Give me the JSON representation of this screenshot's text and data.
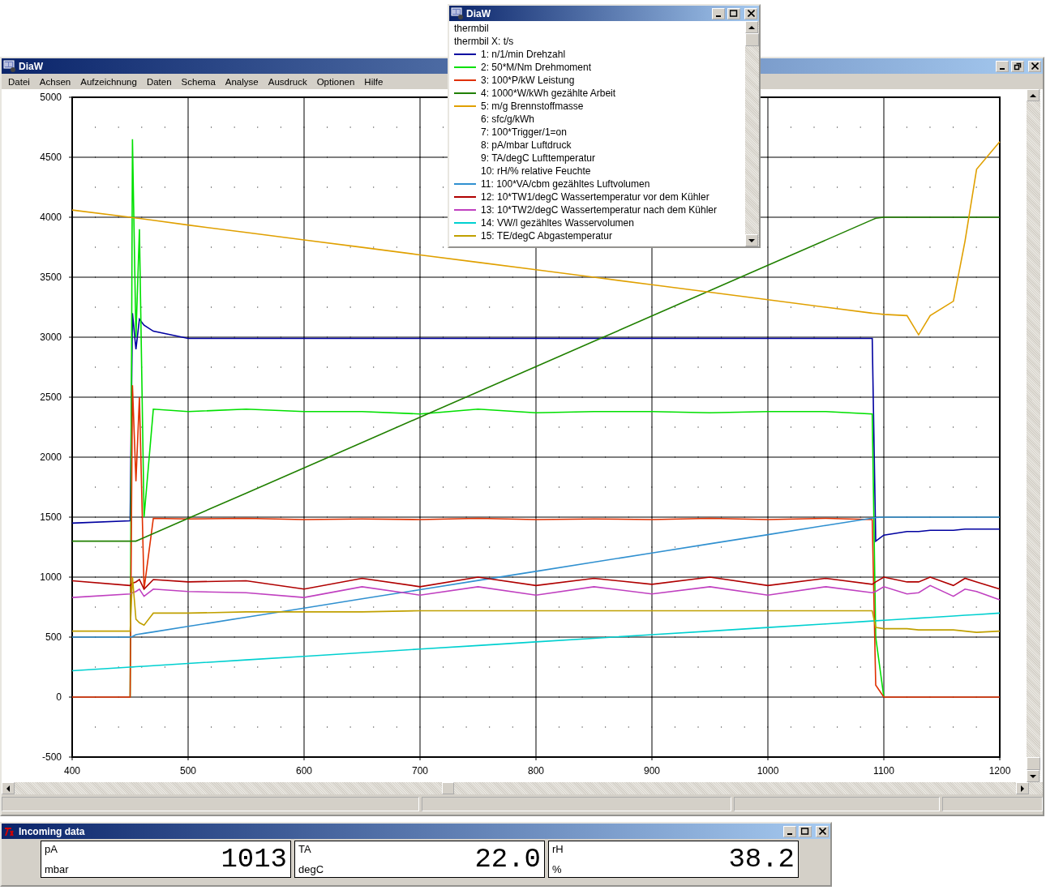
{
  "main_window": {
    "title": "DiaW",
    "menu": [
      "Datei",
      "Achsen",
      "Aufzeichnung",
      "Daten",
      "Schema",
      "Analyse",
      "Ausdruck",
      "Optionen",
      "Hilfe"
    ],
    "chart_data": {
      "type": "line",
      "grid": true,
      "xlim": [
        400,
        1200
      ],
      "ylim": [
        -500,
        5000
      ],
      "xticks": [
        400,
        500,
        600,
        700,
        800,
        900,
        1000,
        1100,
        1200
      ],
      "yticks": [
        -500,
        0,
        500,
        1000,
        1500,
        2000,
        2500,
        3000,
        3500,
        4000,
        4500,
        5000
      ],
      "x": [
        400,
        450,
        452,
        455,
        458,
        462,
        470,
        500,
        550,
        600,
        650,
        700,
        750,
        800,
        850,
        900,
        950,
        1000,
        1050,
        1090,
        1093,
        1100,
        1120,
        1130,
        1140,
        1160,
        1170,
        1180,
        1200
      ],
      "series": [
        {
          "name": "1: n/1/min Drehzahl",
          "color": "#0000a0",
          "values": [
            1450,
            1470,
            3200,
            2900,
            3150,
            3100,
            3050,
            2990,
            2990,
            2990,
            2990,
            2990,
            2990,
            2990,
            2990,
            2990,
            2990,
            2990,
            2990,
            2990,
            1300,
            1350,
            1380,
            1380,
            1390,
            1390,
            1400,
            1400,
            1400
          ]
        },
        {
          "name": "2: 50*M/Nm Drehmoment",
          "color": "#00e000",
          "values": [
            null,
            0,
            4650,
            3000,
            3900,
            1500,
            2400,
            2380,
            2400,
            2380,
            2380,
            2360,
            2400,
            2370,
            2380,
            2380,
            2370,
            2380,
            2380,
            2360,
            500,
            0,
            null,
            null,
            null,
            null,
            null,
            null,
            null
          ]
        },
        {
          "name": "3: 100*P/kW Leistung",
          "color": "#e03000",
          "values": [
            0,
            0,
            2600,
            1800,
            2500,
            900,
            1490,
            1485,
            1490,
            1480,
            1485,
            1480,
            1490,
            1480,
            1485,
            1480,
            1490,
            1480,
            1490,
            1480,
            100,
            0,
            0,
            0,
            0,
            0,
            0,
            0,
            0
          ]
        },
        {
          "name": "4: 1000*W/kWh gezählte Arbeit",
          "color": "#208000",
          "values": [
            1300,
            1300,
            1300,
            1300,
            1313,
            1330,
            1363,
            1490,
            1700,
            1911,
            2122,
            2333,
            2544,
            2755,
            2966,
            3177,
            3388,
            3599,
            3810,
            3979,
            3992,
            4000,
            4000,
            4000,
            4000,
            4000,
            4000,
            4000,
            4000
          ]
        },
        {
          "name": "5: m/g Brennstoffmasse",
          "color": "#e0a000",
          "values": [
            4060,
            4000,
            3997,
            3993,
            3990,
            3985,
            3975,
            3935,
            3873,
            3811,
            3749,
            3686,
            3624,
            3562,
            3500,
            3437,
            3375,
            3312,
            3250,
            3200,
            3198,
            3190,
            3180,
            3020,
            3180,
            3300,
            3800,
            4400,
            4630
          ]
        },
        {
          "name": "11: 100*VA/cbm gezähltes Luftvolumen",
          "color": "#3090d0",
          "values": [
            500,
            500,
            505,
            520,
            525,
            531,
            543,
            589,
            666,
            742,
            819,
            895,
            972,
            1048,
            1125,
            1201,
            1278,
            1354,
            1431,
            1492,
            1497,
            1500,
            1500,
            1500,
            1500,
            1500,
            1500,
            1500,
            1500
          ]
        },
        {
          "name": "12: 10*TW1/degC Wassertemperatur vor dem Kühler",
          "color": "#b00000",
          "values": [
            970,
            930,
            950,
            960,
            980,
            900,
            980,
            960,
            970,
            900,
            990,
            920,
            1000,
            930,
            990,
            940,
            1000,
            930,
            990,
            940,
            960,
            1000,
            960,
            960,
            1000,
            930,
            990,
            960,
            900
          ]
        },
        {
          "name": "13: 10*TW2/degC Wassertemperatur nach dem Kühler",
          "color": "#c040c0",
          "values": [
            830,
            860,
            870,
            880,
            900,
            840,
            900,
            880,
            870,
            830,
            920,
            850,
            920,
            850,
            920,
            860,
            920,
            850,
            920,
            870,
            880,
            920,
            860,
            870,
            930,
            840,
            900,
            880,
            810
          ]
        },
        {
          "name": "14: VW/l gezähltes Wasservolumen",
          "color": "#00d0d0",
          "values": [
            220,
            250,
            251,
            253,
            255,
            257,
            262,
            280,
            310,
            340,
            370,
            400,
            430,
            460,
            490,
            520,
            550,
            580,
            610,
            634,
            636,
            640,
            652,
            658,
            664,
            676,
            682,
            688,
            700
          ]
        },
        {
          "name": "15: TE/degC Abgastemperatur",
          "color": "#c0a000",
          "values": [
            550,
            550,
            1000,
            650,
            620,
            600,
            700,
            700,
            710,
            710,
            710,
            720,
            720,
            720,
            720,
            720,
            720,
            720,
            720,
            720,
            580,
            570,
            570,
            560,
            560,
            560,
            550,
            540,
            550
          ]
        }
      ]
    }
  },
  "legend_window": {
    "title": "DiaW",
    "lines": [
      "thermbil",
      "thermbil X: t/s"
    ],
    "items": [
      {
        "kind": "series"
      },
      {
        "kind": "series"
      },
      {
        "kind": "series"
      },
      {
        "kind": "series"
      },
      {
        "kind": "series"
      },
      {
        "kind": "text",
        "label": "6: sfc/g/kWh"
      },
      {
        "kind": "text",
        "label": "7: 100*Trigger/1=on"
      },
      {
        "kind": "text",
        "label": "8: pA/mbar Luftdruck"
      },
      {
        "kind": "text",
        "label": "9: TA/degC Lufttemperatur"
      },
      {
        "kind": "text",
        "label": "10: rH/% relative Feuchte"
      },
      {
        "kind": "series"
      },
      {
        "kind": "series"
      },
      {
        "kind": "series"
      },
      {
        "kind": "series"
      },
      {
        "kind": "series"
      }
    ]
  },
  "incoming_window": {
    "title": "Incoming data",
    "readings": [
      {
        "name": "pA",
        "unit": "mbar",
        "value": "1013"
      },
      {
        "name": "TA",
        "unit": "degC",
        "value": "22.0"
      },
      {
        "name": "rH",
        "unit": "%",
        "value": "38.2"
      }
    ]
  }
}
